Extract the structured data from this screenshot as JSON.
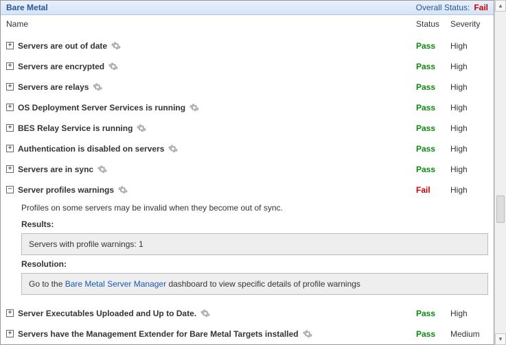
{
  "title": "Bare Metal",
  "overall_label": "Overall Status:",
  "overall_value": "Fail",
  "overall_class": "status-fail",
  "columns": {
    "name": "Name",
    "status": "Status",
    "severity": "Severity"
  },
  "rows": [
    {
      "expander": "+",
      "label": "Servers are out of date",
      "status": "Pass",
      "status_class": "status-pass",
      "severity": "High"
    },
    {
      "expander": "+",
      "label": "Servers are encrypted",
      "status": "Pass",
      "status_class": "status-pass",
      "severity": "High"
    },
    {
      "expander": "+",
      "label": "Servers are relays",
      "status": "Pass",
      "status_class": "status-pass",
      "severity": "High"
    },
    {
      "expander": "+",
      "label": "OS Deployment Server Services is running",
      "status": "Pass",
      "status_class": "status-pass",
      "severity": "High"
    },
    {
      "expander": "+",
      "label": "BES Relay Service is running",
      "status": "Pass",
      "status_class": "status-pass",
      "severity": "High"
    },
    {
      "expander": "+",
      "label": "Authentication is disabled on servers",
      "status": "Pass",
      "status_class": "status-pass",
      "severity": "High"
    },
    {
      "expander": "+",
      "label": "Servers are in sync",
      "status": "Pass",
      "status_class": "status-pass",
      "severity": "High"
    },
    {
      "expander": "−",
      "label": "Server profiles warnings",
      "status": "Fail",
      "status_class": "status-fail",
      "severity": "High"
    },
    {
      "expander": "+",
      "label": "Server Executables Uploaded and Up to Date.",
      "status": "Pass",
      "status_class": "status-pass",
      "severity": "High"
    },
    {
      "expander": "+",
      "label": "Servers have the Management Extender for Bare Metal Targets installed",
      "status": "Pass",
      "status_class": "status-pass",
      "severity": "Medium"
    }
  ],
  "details": {
    "desc": "Profiles on some servers may be invalid when they become out of sync.",
    "results_label": "Results:",
    "results_text": "Servers with profile warnings: 1",
    "resolution_label": "Resolution:",
    "resolution_prefix": "Go to the ",
    "resolution_link": "Bare Metal Server Manager",
    "resolution_suffix": " dashboard to view specific details of profile warnings"
  }
}
